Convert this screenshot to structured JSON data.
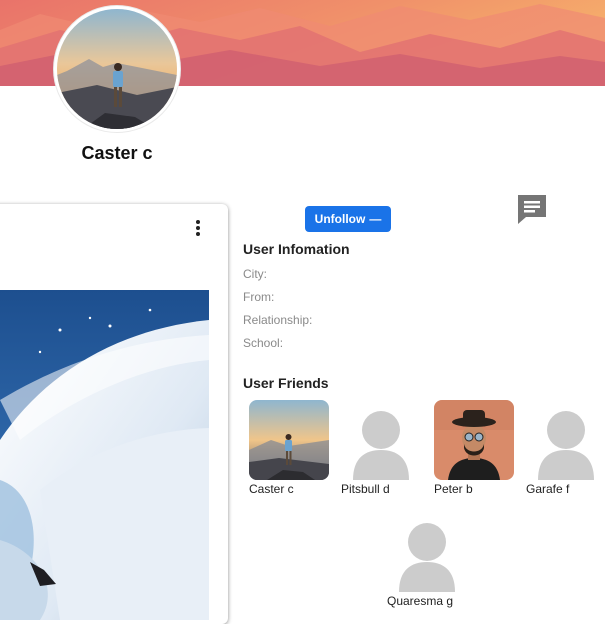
{
  "profile": {
    "name": "Caster c"
  },
  "actions": {
    "unfollow_label": "Unfollow",
    "unfollow_icon": "—"
  },
  "user_info": {
    "title": "User Infomation",
    "fields": [
      {
        "label": "City:",
        "value": ""
      },
      {
        "label": "From:",
        "value": ""
      },
      {
        "label": "Relationship:",
        "value": ""
      },
      {
        "label": "School:",
        "value": ""
      }
    ]
  },
  "friends": {
    "title": "User Friends",
    "items": [
      {
        "name": "Caster c",
        "avatar": "landscape-photo"
      },
      {
        "name": "Pitsbull d",
        "avatar": "default-user-icon"
      },
      {
        "name": "Peter b",
        "avatar": "person-photo"
      },
      {
        "name": "Garafe f",
        "avatar": "default-user-icon"
      },
      {
        "name": "Quaresma g",
        "avatar": "default-user-icon"
      }
    ]
  },
  "colors": {
    "accent": "#1a73e8",
    "muted_text": "#8a8a8a",
    "placeholder_avatar": "#cccccc"
  }
}
